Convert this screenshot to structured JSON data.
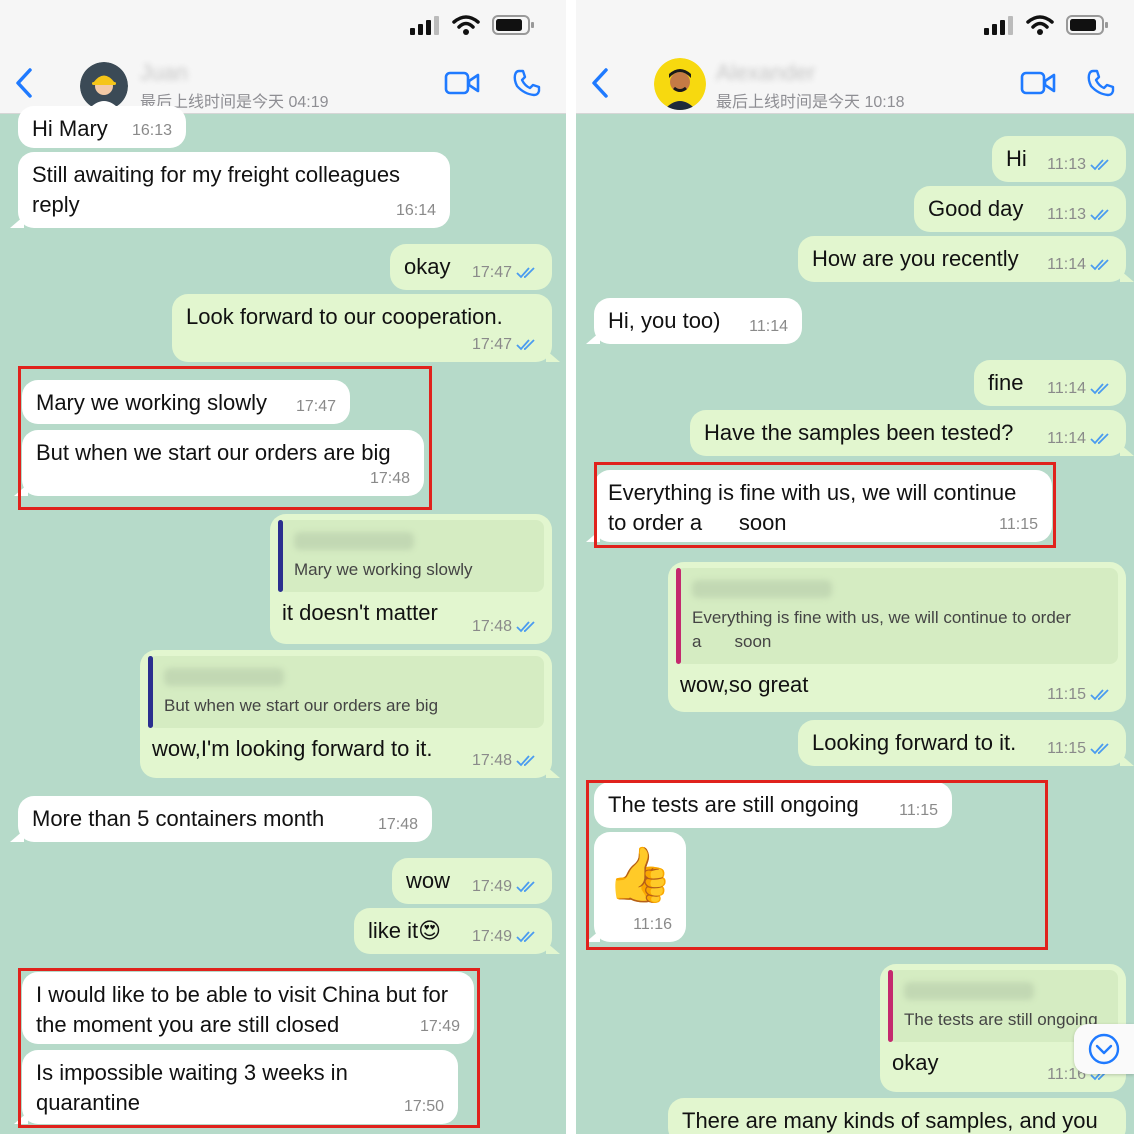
{
  "colors": {
    "chat_bg": "#b6dac9",
    "incoming_bubble": "#ffffff",
    "outgoing_bubble": "#e2f6cf",
    "accent_blue": "#1f7aff",
    "highlight_red": "#e0221c",
    "quote_bar_navy": "#2b2f8f",
    "quote_bar_magenta": "#c4296e"
  },
  "left": {
    "header": {
      "contact_name": "Juan",
      "last_seen": "最后上线时间是今天 04:19"
    },
    "messages": [
      {
        "dir": "in",
        "text": "Hi Mary",
        "time": "16:13"
      },
      {
        "dir": "in",
        "text": "Still awaiting for my freight colleagues\nreply",
        "time": "16:14"
      },
      {
        "dir": "out",
        "text": "okay",
        "time": "17:47"
      },
      {
        "dir": "out",
        "text": "Look forward to our cooperation.",
        "time": "17:47"
      },
      {
        "dir": "in",
        "text": "Mary we working slowly",
        "time": "17:47"
      },
      {
        "dir": "in",
        "text": "But when we start our orders are big",
        "time": "17:48"
      },
      {
        "dir": "out",
        "quote": "Mary we working slowly",
        "text": "it doesn't matter",
        "time": "17:48"
      },
      {
        "dir": "out",
        "quote": "But when we start our orders are big",
        "text": "wow,I'm looking forward to it.",
        "time": "17:48"
      },
      {
        "dir": "in",
        "text": "More than 5 containers month",
        "time": "17:48"
      },
      {
        "dir": "out",
        "text": "wow",
        "time": "17:49"
      },
      {
        "dir": "out",
        "text": "like it😍",
        "time": "17:49"
      },
      {
        "dir": "in",
        "text": "I would like to be able to visit China but for\nthe moment you are still closed",
        "time": "17:49"
      },
      {
        "dir": "in",
        "text": "Is impossible waiting 3 weeks in\nquarantine",
        "time": "17:50"
      }
    ]
  },
  "right": {
    "header": {
      "contact_name": "Alexander",
      "last_seen": "最后上线时间是今天 10:18"
    },
    "messages": [
      {
        "dir": "out",
        "text": "Hi",
        "time": "11:13"
      },
      {
        "dir": "out",
        "text": "Good day",
        "time": "11:13"
      },
      {
        "dir": "out",
        "text": "How are you recently",
        "time": "11:14"
      },
      {
        "dir": "in",
        "text": "Hi, you too)",
        "time": "11:14"
      },
      {
        "dir": "out",
        "text": "fine",
        "time": "11:14"
      },
      {
        "dir": "out",
        "text": "Have the samples been tested?",
        "time": "11:14"
      },
      {
        "dir": "in",
        "text": "Everything is fine with us, we will continue\nto order a      soon",
        "time": "11:15"
      },
      {
        "dir": "out",
        "quote": "Everything is fine with us, we will continue to order\na       soon",
        "text": "wow,so great",
        "time": "11:15"
      },
      {
        "dir": "out",
        "text": "Looking forward to it.",
        "time": "11:15"
      },
      {
        "dir": "in",
        "text": "The tests are still ongoing",
        "time": "11:15"
      },
      {
        "dir": "in",
        "emoji": "👍",
        "time": "11:16"
      },
      {
        "dir": "out",
        "quote": "The tests are still ongoing",
        "text": "okay",
        "time": "11:16"
      },
      {
        "dir": "out",
        "text": "There are many kinds of samples, and you",
        "time": ""
      }
    ]
  }
}
